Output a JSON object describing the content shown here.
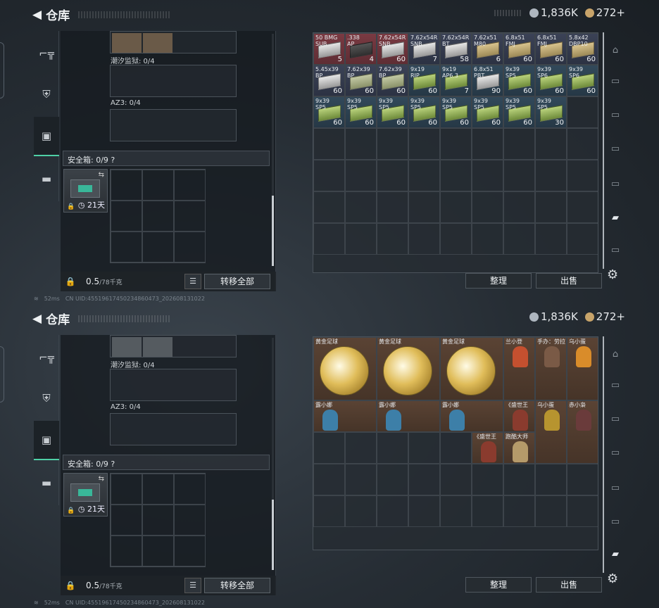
{
  "header": {
    "back_icon": "back-arrow-icon",
    "title": "仓库"
  },
  "currency": {
    "silver": "1,836K",
    "gold": "272",
    "plus": "+"
  },
  "left_panel": {
    "tide_label": "潮汐监狱: 0/4",
    "az3_label": "AZ3: 0/4",
    "safe_label": "安全箱: 0/9",
    "safe_help": "?",
    "safe_days": "21天",
    "weight_value": "0.5",
    "weight_max": "/78千克",
    "transfer_label": "转移全部"
  },
  "buttons": {
    "sort": "整理",
    "sell": "出售"
  },
  "status": {
    "ping": "52ms",
    "uid": "CN UID:455196174502348604​73_202608131022"
  },
  "top_inventory": [
    {
      "name": "50 BMG\nSUB",
      "count": "5",
      "style": "red",
      "box": "w"
    },
    {
      "name": ".338\nAP",
      "count": "4",
      "style": "red",
      "box": "dk"
    },
    {
      "name": "7.62x54R\nSNB",
      "count": "60",
      "style": "red",
      "box": "w"
    },
    {
      "name": "7.62x54R\nSNB",
      "count": "7",
      "style": "navy",
      "box": "w"
    },
    {
      "name": "7.62x54R\nBT",
      "count": "58",
      "style": "navy",
      "box": "w"
    },
    {
      "name": "7.62x51\nM80",
      "count": "6",
      "style": "navy",
      "box": "y"
    },
    {
      "name": "6.8x51\nFMJ",
      "count": "60",
      "style": "navy",
      "box": "y"
    },
    {
      "name": "6.8x51\nFMJ",
      "count": "60",
      "style": "navy",
      "box": "y"
    },
    {
      "name": "5.8x42\nDBP10",
      "count": "60",
      "style": "navy",
      "box": "y"
    },
    {
      "name": "5.45x39\nBP",
      "count": "60",
      "style": "navy",
      "box": "w"
    },
    {
      "name": "7.62x39\nBP",
      "count": "60",
      "style": "navy",
      "box": "g"
    },
    {
      "name": "7.62x39\nBP",
      "count": "60",
      "style": "navy",
      "box": "g"
    },
    {
      "name": "9x19\nRIP",
      "count": "60",
      "style": "teal",
      "box": "gr"
    },
    {
      "name": "9x19\nAP6.3",
      "count": "7",
      "style": "teal",
      "box": "gr"
    },
    {
      "name": "6.8x51\nPBT",
      "count": "90",
      "style": "teal",
      "box": "w"
    },
    {
      "name": "9x39\nSP5",
      "count": "60",
      "style": "teal",
      "box": "gr"
    },
    {
      "name": "9x39\nSP6",
      "count": "60",
      "style": "teal",
      "box": "gr"
    },
    {
      "name": "9x39\nSP6",
      "count": "60",
      "style": "teal",
      "box": "gr"
    },
    {
      "name": "9x39\nSP5",
      "count": "60",
      "style": "teal",
      "box": "gr"
    },
    {
      "name": "9x39\nSP5",
      "count": "60",
      "style": "teal",
      "box": "gr"
    },
    {
      "name": "9x39\nSP5",
      "count": "60",
      "style": "teal",
      "box": "gr"
    },
    {
      "name": "9x39\nSP5",
      "count": "60",
      "style": "teal",
      "box": "gr"
    },
    {
      "name": "9x39\nSP5",
      "count": "60",
      "style": "teal",
      "box": "gr"
    },
    {
      "name": "9x39\nSP5",
      "count": "60",
      "style": "teal",
      "box": "gr"
    },
    {
      "name": "9x39\nSP5",
      "count": "60",
      "style": "teal",
      "box": "gr"
    },
    {
      "name": "9x39\nSP5",
      "count": "30",
      "style": "teal",
      "box": "gr"
    }
  ],
  "bottom_items": {
    "ball": "黄金足球",
    "row1": [
      "兰小登",
      "手办：劳拉",
      "乌小蛋"
    ],
    "row2": [
      "露小娜",
      "露小娜",
      "露小娜",
      "《盛世王",
      "乌小蛋",
      "赤小枭"
    ],
    "row3": [
      "《盛世王",
      "跑酷大师"
    ]
  },
  "icons": {
    "weapon": "pistol-icon",
    "armor": "armor-icon",
    "bag": "backpack-icon",
    "box": "toolbox-icon",
    "settings": "gear-icon"
  }
}
